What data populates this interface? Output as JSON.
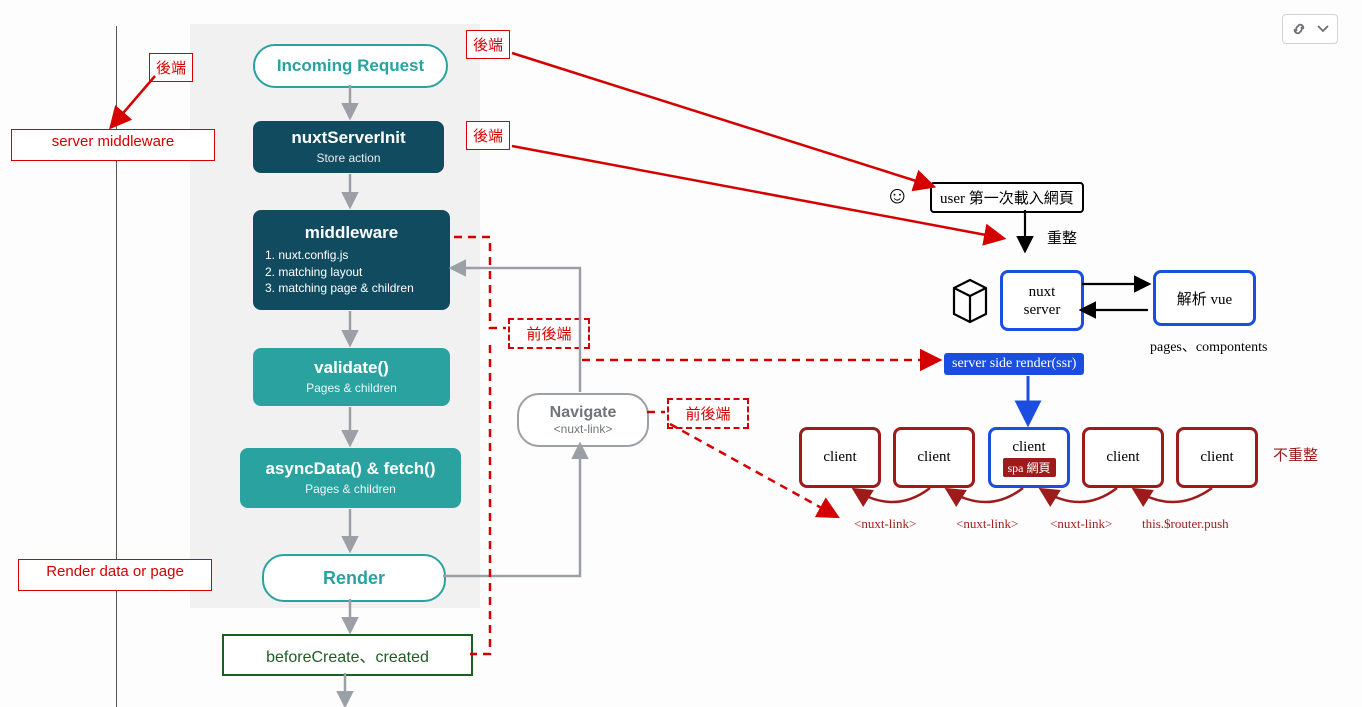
{
  "flow": {
    "incoming": "Incoming Request",
    "serverInit": {
      "title": "nuxtServerInit",
      "sub": "Store action"
    },
    "middleware": {
      "title": "middleware",
      "items": [
        "1. nuxt.config.js",
        "2. matching layout",
        "3. matching page & children"
      ]
    },
    "validate": {
      "title": "validate()",
      "sub": "Pages & children"
    },
    "asyncFetch": {
      "title": "asyncData() & fetch()",
      "sub": "Pages & children"
    },
    "render": "Render",
    "lifecycle": "beforeCreate、created",
    "navigate": {
      "title": "Navigate",
      "sub": "<nuxt-link>"
    }
  },
  "annotations": {
    "backend1": "後端",
    "backend2": "後端",
    "backend3": "後端",
    "frontback1": "前後端",
    "frontback2": "前後端",
    "serverMiddleware": "server middleware",
    "renderDataOrPage": "Render data or page"
  },
  "right": {
    "userLoad": "user 第一次載入網頁",
    "reload": "重整",
    "nuxtServer": "nuxt\nserver",
    "parseVue": "解析 vue",
    "pagesComponents": "pages、compontents",
    "ssr": "server side render(ssr)",
    "client": "client",
    "spa": "spa 網頁",
    "nuxtLink": "<nuxt-link>",
    "routerPush": "this.$router.push",
    "noReload": "不重整"
  },
  "toolbar": {
    "link_icon": "link-icon",
    "chevron_icon": "chevron-down-icon"
  }
}
